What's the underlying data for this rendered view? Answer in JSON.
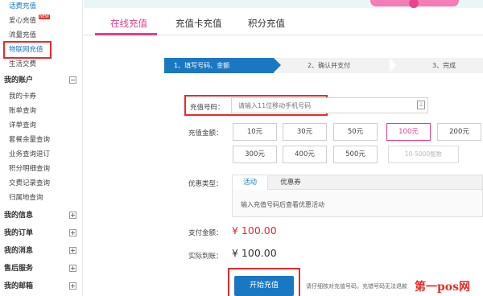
{
  "sidebar": {
    "top_items": [
      {
        "label": "话费充值",
        "color": "blue"
      },
      {
        "label": "爱心充值",
        "badge": "NEW"
      },
      {
        "label": "流量充值"
      },
      {
        "label": "物联网充值",
        "color": "blue"
      },
      {
        "label": "生活交费"
      }
    ],
    "account_group": {
      "label": "我的账户",
      "toggle": "⊟"
    },
    "account_items": [
      {
        "label": "我的卡券"
      },
      {
        "label": "账单查询"
      },
      {
        "label": "详单查询"
      },
      {
        "label": "套餐余量查询"
      },
      {
        "label": "业务查询退订"
      },
      {
        "label": "积分明细查询"
      },
      {
        "label": "交费记录查询"
      },
      {
        "label": "归属地查询"
      }
    ],
    "collapsed_groups": [
      {
        "label": "我的信息",
        "toggle": "⊞"
      },
      {
        "label": "我的订单",
        "toggle": "⊞"
      },
      {
        "label": "我的消息",
        "toggle": "⊞"
      },
      {
        "label": "售后服务",
        "toggle": "⊞"
      },
      {
        "label": "我的邮箱",
        "toggle": "⊞"
      }
    ]
  },
  "tabs": [
    {
      "label": "在线充值",
      "active": true
    },
    {
      "label": "充值卡充值",
      "active": false
    },
    {
      "label": "积分充值",
      "active": false
    }
  ],
  "steps": [
    {
      "label": "1、填写号码、金额",
      "active": true
    },
    {
      "label": "2、确认并支付",
      "active": false
    },
    {
      "label": "3、完成",
      "active": false
    }
  ],
  "form": {
    "phone_label": "充值号码：",
    "phone_placeholder": "请输入11位移动手机号码",
    "contact_icon": "contact-book-icon",
    "amount_label": "充值金额：",
    "amounts": [
      "10元",
      "30元",
      "50元",
      "100元",
      "200元",
      "300元",
      "400元",
      "500元"
    ],
    "selected_amount": "100元",
    "custom_amount_placeholder": "10-5000整数",
    "promo_label": "优惠类型：",
    "promo_tabs": [
      "活动",
      "优惠券"
    ],
    "promo_message": "输入充值号码后查看优惠活动",
    "pay_label": "支付金额：",
    "pay_amount": "¥ 100.00",
    "received_label": "实际到账：",
    "received_amount": "¥ 100.00",
    "submit_label": "开始充值",
    "hint": "请仔细核对充值号码，充错号码无法退款"
  },
  "colors": {
    "accent_pink": "#e63d8c",
    "primary_blue": "#1a78c2",
    "highlight_red": "#e62b2b"
  },
  "watermark": "第一pos网"
}
